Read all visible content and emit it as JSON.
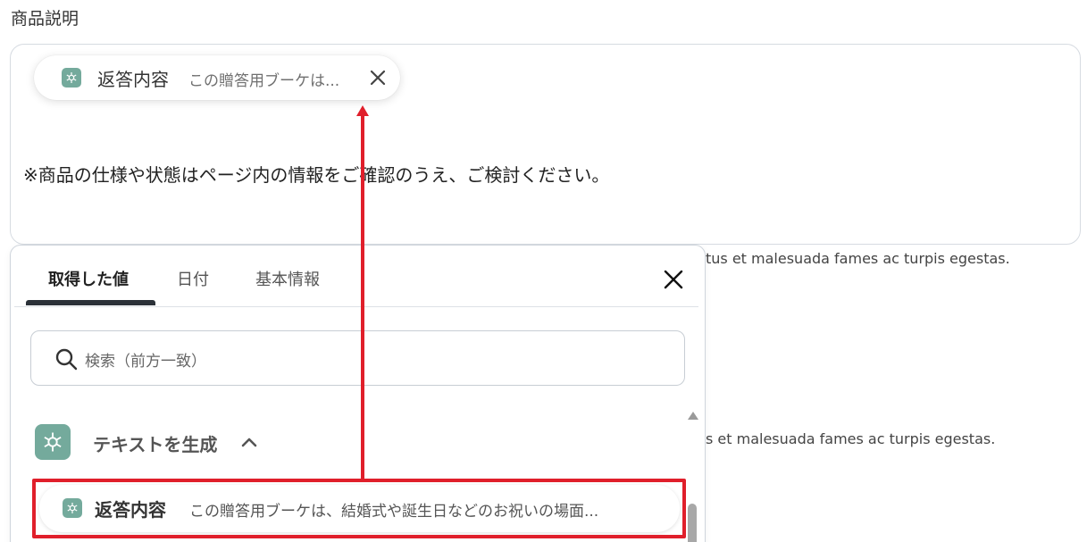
{
  "section": {
    "title": "商品説明"
  },
  "field": {
    "chip": {
      "label": "返答内容",
      "value": "この贈答用ブーケは...",
      "icon": "openai-icon"
    },
    "text": "※商品の仕様や状態はページ内の情報をご確認のうえ、ご検討ください。"
  },
  "background_text": {
    "line1": "tus et malesuada fames ac turpis egestas.",
    "line2": "s et malesuada fames ac turpis egestas."
  },
  "picker": {
    "tabs": [
      {
        "label": "取得した値",
        "active": true
      },
      {
        "label": "日付",
        "active": false
      },
      {
        "label": "基本情報",
        "active": false
      }
    ],
    "search_placeholder": "検索（前方一致）",
    "group": {
      "title": "テキストを生成",
      "expanded": true,
      "icon": "openai-icon"
    },
    "item": {
      "label": "返答内容",
      "value": "この贈答用ブーケは、結婚式や誕生日などのお祝いの場面...",
      "icon": "openai-icon"
    }
  },
  "colors": {
    "accent_red": "#e01f2b",
    "openai_green": "#74aa9c",
    "tab_active_underline": "#2b3138"
  }
}
